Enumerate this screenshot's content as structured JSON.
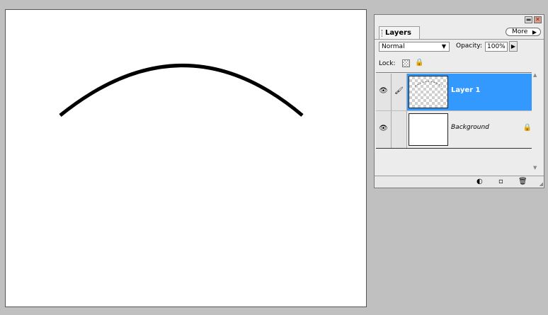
{
  "panel": {
    "tab_label": "Layers",
    "more_label": "More",
    "blend_mode": "Normal",
    "opacity_label": "Opacity:",
    "opacity_value": "100%",
    "lock_label": "Lock:"
  },
  "layers": [
    {
      "name": "Layer 1",
      "selected": true,
      "visible": true
    },
    {
      "name": "Background",
      "selected": false,
      "visible": true,
      "locked": true
    }
  ],
  "colors": {
    "selection": "#3399ff",
    "workspace": "#c0c0c0",
    "canvas": "#ffffff"
  },
  "icons": {
    "eye": "eye-icon",
    "brush": "brush-icon",
    "lock": "lock-icon",
    "new_fill_layer": "adjustment-layer-icon",
    "new_layer": "new-layer-icon",
    "delete": "trash-icon"
  }
}
